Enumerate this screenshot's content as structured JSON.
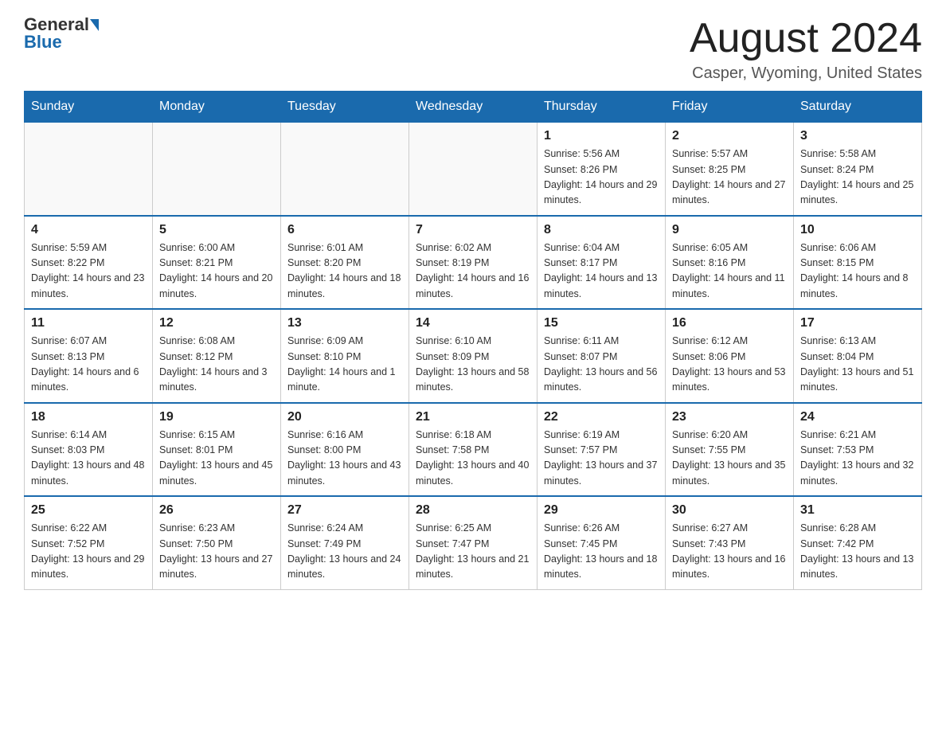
{
  "header": {
    "logo_general": "General",
    "logo_blue": "Blue",
    "month_year": "August 2024",
    "location": "Casper, Wyoming, United States"
  },
  "days_of_week": [
    "Sunday",
    "Monday",
    "Tuesday",
    "Wednesday",
    "Thursday",
    "Friday",
    "Saturday"
  ],
  "weeks": [
    [
      {
        "day": "",
        "info": ""
      },
      {
        "day": "",
        "info": ""
      },
      {
        "day": "",
        "info": ""
      },
      {
        "day": "",
        "info": ""
      },
      {
        "day": "1",
        "info": "Sunrise: 5:56 AM\nSunset: 8:26 PM\nDaylight: 14 hours and 29 minutes."
      },
      {
        "day": "2",
        "info": "Sunrise: 5:57 AM\nSunset: 8:25 PM\nDaylight: 14 hours and 27 minutes."
      },
      {
        "day": "3",
        "info": "Sunrise: 5:58 AM\nSunset: 8:24 PM\nDaylight: 14 hours and 25 minutes."
      }
    ],
    [
      {
        "day": "4",
        "info": "Sunrise: 5:59 AM\nSunset: 8:22 PM\nDaylight: 14 hours and 23 minutes."
      },
      {
        "day": "5",
        "info": "Sunrise: 6:00 AM\nSunset: 8:21 PM\nDaylight: 14 hours and 20 minutes."
      },
      {
        "day": "6",
        "info": "Sunrise: 6:01 AM\nSunset: 8:20 PM\nDaylight: 14 hours and 18 minutes."
      },
      {
        "day": "7",
        "info": "Sunrise: 6:02 AM\nSunset: 8:19 PM\nDaylight: 14 hours and 16 minutes."
      },
      {
        "day": "8",
        "info": "Sunrise: 6:04 AM\nSunset: 8:17 PM\nDaylight: 14 hours and 13 minutes."
      },
      {
        "day": "9",
        "info": "Sunrise: 6:05 AM\nSunset: 8:16 PM\nDaylight: 14 hours and 11 minutes."
      },
      {
        "day": "10",
        "info": "Sunrise: 6:06 AM\nSunset: 8:15 PM\nDaylight: 14 hours and 8 minutes."
      }
    ],
    [
      {
        "day": "11",
        "info": "Sunrise: 6:07 AM\nSunset: 8:13 PM\nDaylight: 14 hours and 6 minutes."
      },
      {
        "day": "12",
        "info": "Sunrise: 6:08 AM\nSunset: 8:12 PM\nDaylight: 14 hours and 3 minutes."
      },
      {
        "day": "13",
        "info": "Sunrise: 6:09 AM\nSunset: 8:10 PM\nDaylight: 14 hours and 1 minute."
      },
      {
        "day": "14",
        "info": "Sunrise: 6:10 AM\nSunset: 8:09 PM\nDaylight: 13 hours and 58 minutes."
      },
      {
        "day": "15",
        "info": "Sunrise: 6:11 AM\nSunset: 8:07 PM\nDaylight: 13 hours and 56 minutes."
      },
      {
        "day": "16",
        "info": "Sunrise: 6:12 AM\nSunset: 8:06 PM\nDaylight: 13 hours and 53 minutes."
      },
      {
        "day": "17",
        "info": "Sunrise: 6:13 AM\nSunset: 8:04 PM\nDaylight: 13 hours and 51 minutes."
      }
    ],
    [
      {
        "day": "18",
        "info": "Sunrise: 6:14 AM\nSunset: 8:03 PM\nDaylight: 13 hours and 48 minutes."
      },
      {
        "day": "19",
        "info": "Sunrise: 6:15 AM\nSunset: 8:01 PM\nDaylight: 13 hours and 45 minutes."
      },
      {
        "day": "20",
        "info": "Sunrise: 6:16 AM\nSunset: 8:00 PM\nDaylight: 13 hours and 43 minutes."
      },
      {
        "day": "21",
        "info": "Sunrise: 6:18 AM\nSunset: 7:58 PM\nDaylight: 13 hours and 40 minutes."
      },
      {
        "day": "22",
        "info": "Sunrise: 6:19 AM\nSunset: 7:57 PM\nDaylight: 13 hours and 37 minutes."
      },
      {
        "day": "23",
        "info": "Sunrise: 6:20 AM\nSunset: 7:55 PM\nDaylight: 13 hours and 35 minutes."
      },
      {
        "day": "24",
        "info": "Sunrise: 6:21 AM\nSunset: 7:53 PM\nDaylight: 13 hours and 32 minutes."
      }
    ],
    [
      {
        "day": "25",
        "info": "Sunrise: 6:22 AM\nSunset: 7:52 PM\nDaylight: 13 hours and 29 minutes."
      },
      {
        "day": "26",
        "info": "Sunrise: 6:23 AM\nSunset: 7:50 PM\nDaylight: 13 hours and 27 minutes."
      },
      {
        "day": "27",
        "info": "Sunrise: 6:24 AM\nSunset: 7:49 PM\nDaylight: 13 hours and 24 minutes."
      },
      {
        "day": "28",
        "info": "Sunrise: 6:25 AM\nSunset: 7:47 PM\nDaylight: 13 hours and 21 minutes."
      },
      {
        "day": "29",
        "info": "Sunrise: 6:26 AM\nSunset: 7:45 PM\nDaylight: 13 hours and 18 minutes."
      },
      {
        "day": "30",
        "info": "Sunrise: 6:27 AM\nSunset: 7:43 PM\nDaylight: 13 hours and 16 minutes."
      },
      {
        "day": "31",
        "info": "Sunrise: 6:28 AM\nSunset: 7:42 PM\nDaylight: 13 hours and 13 minutes."
      }
    ]
  ]
}
